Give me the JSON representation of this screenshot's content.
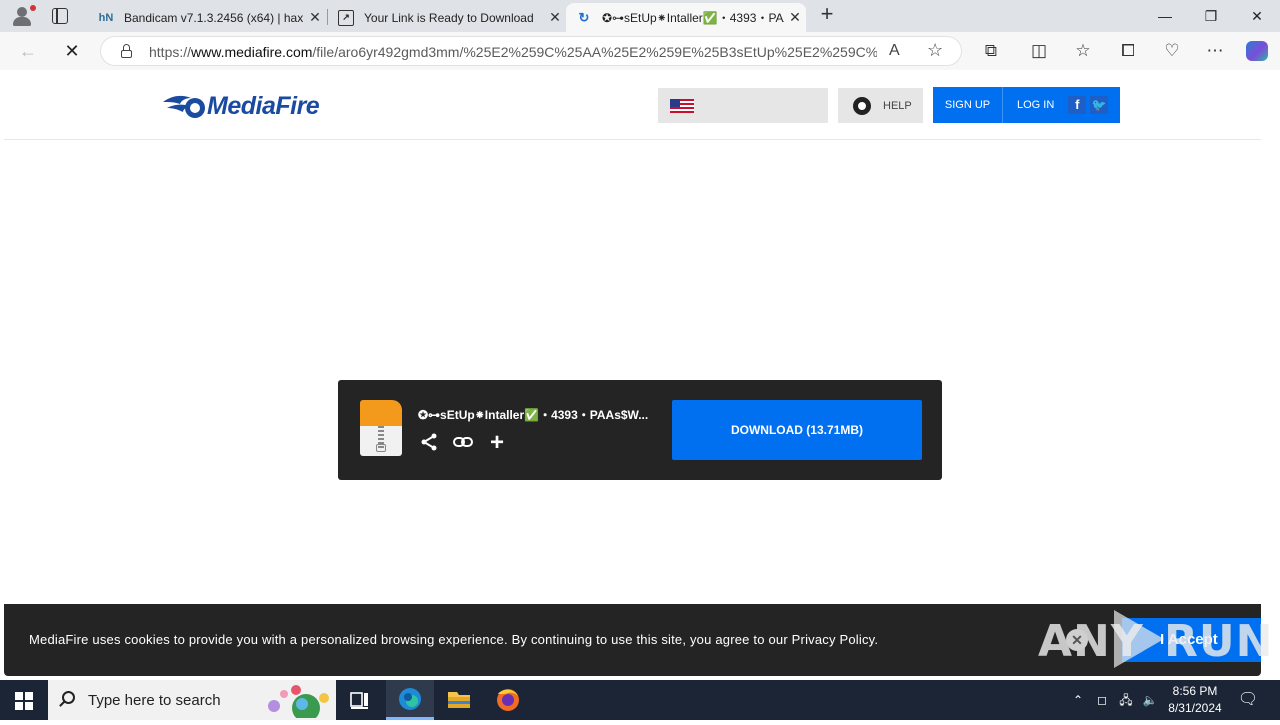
{
  "browser": {
    "tabs": [
      {
        "title": "Bandicam v7.1.3.2456 (x64) | hax",
        "favicon": "hn"
      },
      {
        "title": "Your Link is Ready to Download",
        "favicon": "page-icon"
      },
      {
        "title": "✪⊶sEtUp⁕Intaller✅・4393・PAAs",
        "favicon": "loading-spinner"
      }
    ],
    "url_prefix": "https://",
    "url_domain": "www.mediafire.com",
    "url_path": "/file/aro6yr492gmd3mm/%25E2%259C%25AA%25E2%259E%25B3sEtUp%25E2%259C%2..."
  },
  "site": {
    "logo_text": "MediaFire",
    "help_label": "HELP",
    "signup_label": "SIGN UP",
    "login_label": "LOG IN"
  },
  "download": {
    "filename": "✪⊶sEtUp⁕Intaller✅・4393・PAAs$W...",
    "button_label": "DOWNLOAD (13.71MB)"
  },
  "cookie": {
    "text": "MediaFire uses cookies to provide you with a personalized browsing experience. By continuing to use this site, you agree to our Privacy Policy.",
    "accept_label": "I Accept"
  },
  "watermark": {
    "any": "ANY",
    "run": "RUN"
  },
  "taskbar": {
    "search_placeholder": "Type here to search",
    "time": "8:56 PM",
    "date": "8/31/2024"
  },
  "colors": {
    "accent": "#0070f0",
    "brand": "#1a4ba0",
    "card": "#242424"
  }
}
